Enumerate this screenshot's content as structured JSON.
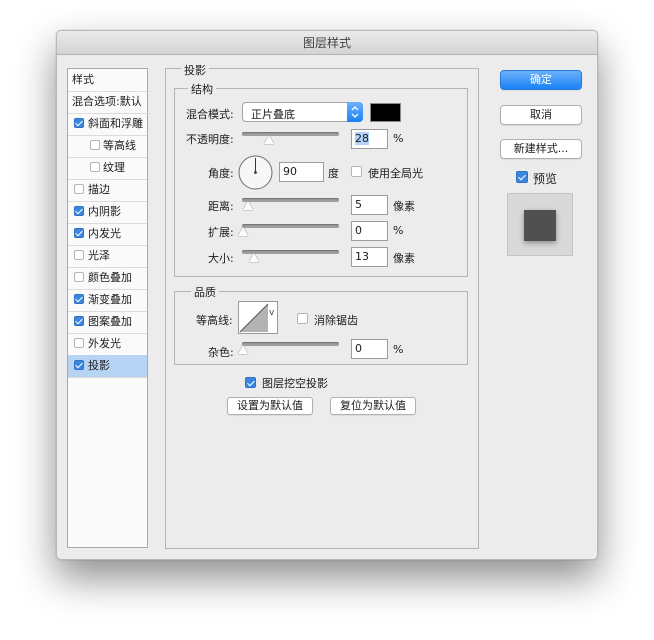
{
  "window": {
    "title": "图层样式"
  },
  "styles": {
    "header": "样式",
    "blend_options": "混合选项:默认",
    "items": [
      {
        "label": "斜面和浮雕",
        "checked": true
      },
      {
        "label": "等高线",
        "checked": false
      },
      {
        "label": "纹理",
        "checked": false
      },
      {
        "label": "描边",
        "checked": false
      },
      {
        "label": "内阴影",
        "checked": true
      },
      {
        "label": "内发光",
        "checked": true
      },
      {
        "label": "光泽",
        "checked": false
      },
      {
        "label": "颜色叠加",
        "checked": false
      },
      {
        "label": "渐变叠加",
        "checked": true
      },
      {
        "label": "图案叠加",
        "checked": true
      },
      {
        "label": "外发光",
        "checked": false
      },
      {
        "label": "投影",
        "checked": true,
        "selected": true
      }
    ]
  },
  "panel": {
    "title": "投影",
    "structure": {
      "title": "结构",
      "blend_mode_label": "混合模式:",
      "blend_mode_value": "正片叠底",
      "color": "#000000",
      "opacity_label": "不透明度:",
      "opacity_value": "28",
      "opacity_unit": "%",
      "angle_label": "角度:",
      "angle_value": "90",
      "angle_unit": "度",
      "global_light_label": "使用全局光",
      "global_light_checked": false,
      "distance_label": "距离:",
      "distance_value": "5",
      "distance_unit": "像素",
      "spread_label": "扩展:",
      "spread_value": "0",
      "spread_unit": "%",
      "size_label": "大小:",
      "size_value": "13",
      "size_unit": "像素"
    },
    "quality": {
      "title": "品质",
      "contour_label": "等高线:",
      "antialias_label": "消除锯齿",
      "antialias_checked": false,
      "noise_label": "杂色:",
      "noise_value": "0",
      "noise_unit": "%"
    },
    "knockout_label": "图层挖空投影",
    "knockout_checked": true,
    "make_default": "设置为默认值",
    "reset_default": "复位为默认值"
  },
  "buttons": {
    "ok": "确定",
    "cancel": "取消",
    "new_style": "新建样式...",
    "preview_label": "预览",
    "preview_checked": true
  }
}
